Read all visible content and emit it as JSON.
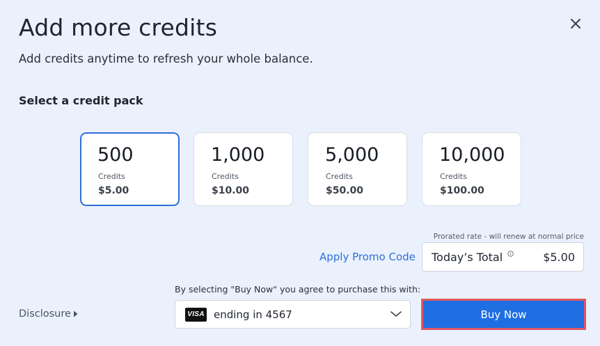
{
  "dialog": {
    "title": "Add more credits",
    "subtitle": "Add credits anytime to refresh your whole balance.",
    "close_icon": "close-icon"
  },
  "packs_section": {
    "label": "Select a credit pack",
    "packs": [
      {
        "amount": "500",
        "unit": "Credits",
        "price": "$5.00",
        "selected": true
      },
      {
        "amount": "1,000",
        "unit": "Credits",
        "price": "$10.00",
        "selected": false
      },
      {
        "amount": "5,000",
        "unit": "Credits",
        "price": "$50.00",
        "selected": false
      },
      {
        "amount": "10,000",
        "unit": "Credits",
        "price": "$100.00",
        "selected": false
      }
    ]
  },
  "summary": {
    "prorated_note": "Prorated rate - will renew at normal price",
    "promo_link": "Apply Promo Code",
    "total_label": "Today’s Total",
    "total_amount": "$5.00"
  },
  "payment": {
    "agreement": "By selecting \"Buy Now\" you agree to purchase this with:",
    "card_brand": "VISA",
    "card_text": "ending in 4567",
    "buy_label": "Buy Now"
  },
  "footer": {
    "disclosure_label": "Disclosure"
  },
  "colors": {
    "background": "#eaf1fc",
    "accent": "#1f6fe3",
    "selected_border": "#2f6fd6",
    "highlight_outline": "#e25563"
  }
}
